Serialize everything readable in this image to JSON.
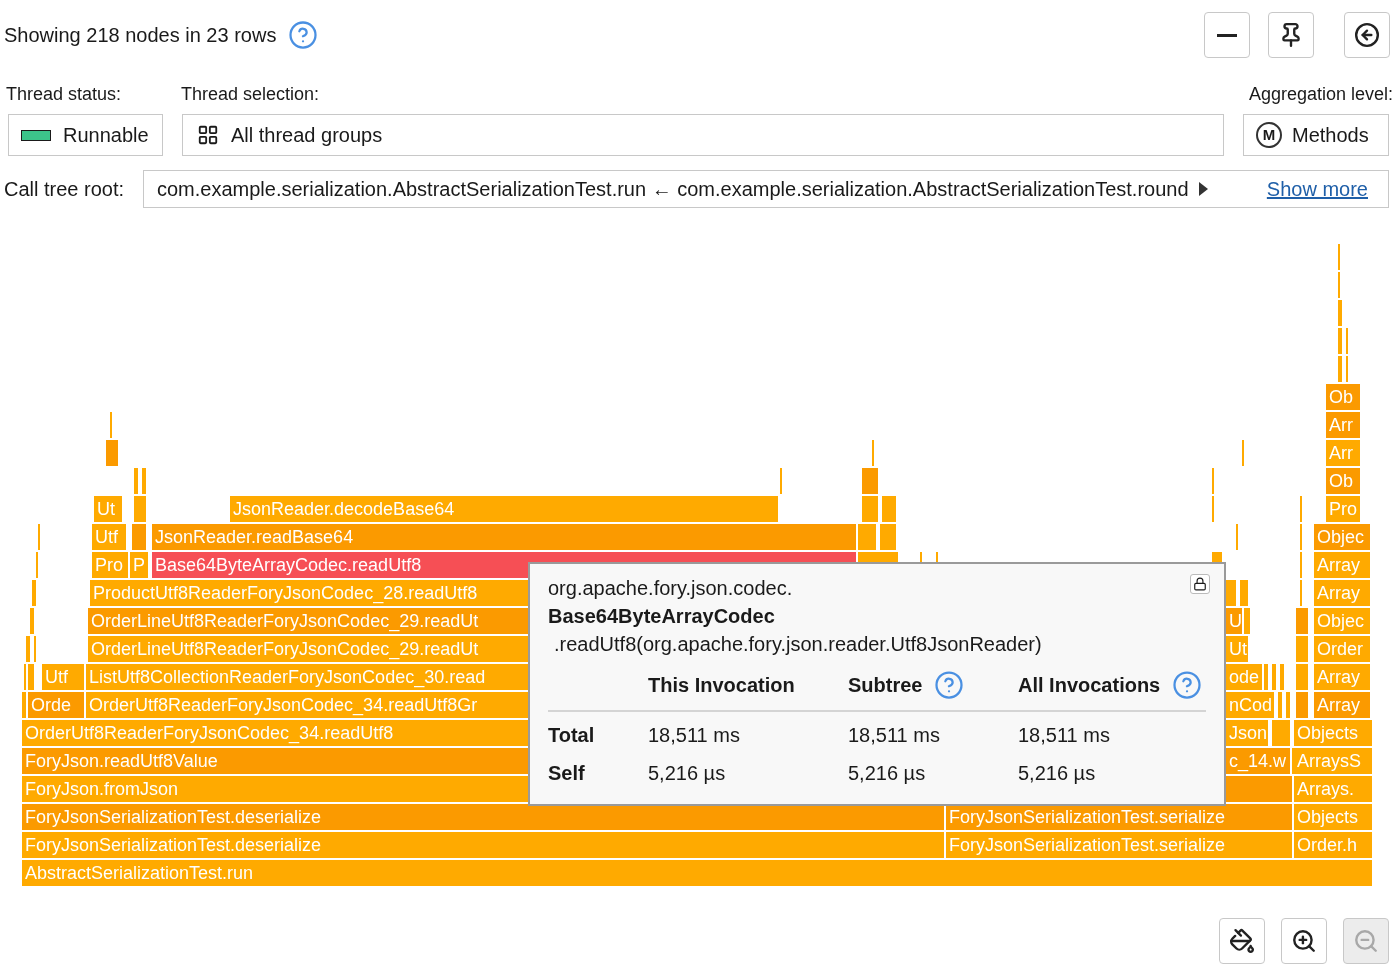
{
  "header": {
    "summary": "Showing 218 nodes in 23 rows"
  },
  "toolbar": [
    {
      "kind": "collapse",
      "disabled": false
    },
    {
      "kind": "pin",
      "disabled": false
    },
    {
      "kind": "back",
      "disabled": false
    }
  ],
  "thread_status": {
    "label": "Thread status:",
    "value": "Runnable",
    "color": "#3cc48a"
  },
  "thread_selection": {
    "label": "Thread selection:",
    "value": "All thread groups"
  },
  "aggregation": {
    "label": "Aggregation level:",
    "icon_letter": "M",
    "value": "Methods"
  },
  "call_tree_root": {
    "label": "Call tree root:",
    "value": "com.example.serialization.AbstractSerializationTest.run ← com.example.serialization.AbstractSerializationTest.round",
    "link": "Show more"
  },
  "frames": [
    {
      "label": "Ob",
      "selected": false
    },
    {
      "label": "Arr",
      "selected": false
    },
    {
      "label": "Arr",
      "selected": false
    },
    {
      "label": "Ob",
      "selected": false
    },
    {
      "label": "Ut",
      "selected": false
    },
    {
      "label": "JsonReader.decodeBase64",
      "selected": false
    },
    {
      "label": "Pro",
      "selected": false
    },
    {
      "label": "Utf",
      "selected": false
    },
    {
      "label": "JsonReader.readBase64",
      "selected": false
    },
    {
      "label": "Objec",
      "selected": false
    },
    {
      "label": "Pro",
      "selected": false
    },
    {
      "label": "P",
      "selected": false
    },
    {
      "label": "Base64ByteArrayCodec.readUtf8",
      "selected": true
    },
    {
      "label": "Array",
      "selected": false
    },
    {
      "label": "ProductUtf8ReaderForyJsonCodec_28.readUtf8",
      "selected": false
    },
    {
      "label": "Array",
      "selected": false
    },
    {
      "label": "OrderLineUtf8ReaderForyJsonCodec_29.readUt",
      "selected": false
    },
    {
      "label": "U",
      "selected": false
    },
    {
      "label": "Objec",
      "selected": false
    },
    {
      "label": "OrderLineUtf8ReaderForyJsonCodec_29.readUt",
      "selected": false
    },
    {
      "label": "Ut",
      "selected": false
    },
    {
      "label": "Order",
      "selected": false
    },
    {
      "label": "Utf",
      "selected": false
    },
    {
      "label": "ListUtf8CollectionReaderForyJsonCodec_30.read",
      "selected": false
    },
    {
      "label": "ode",
      "selected": false
    },
    {
      "label": "Array",
      "selected": false
    },
    {
      "label": "Orde",
      "selected": false
    },
    {
      "label": "OrderUtf8ReaderForyJsonCodec_34.readUtf8Gr",
      "selected": false
    },
    {
      "label": "nCod",
      "selected": false
    },
    {
      "label": "Array",
      "selected": false
    },
    {
      "label": "OrderUtf8ReaderForyJsonCodec_34.readUtf8",
      "selected": false
    },
    {
      "label": "Json",
      "selected": false
    },
    {
      "label": "Objects",
      "selected": false
    },
    {
      "label": "ForyJson.readUtf8Value",
      "selected": false
    },
    {
      "label": "c_14.w",
      "selected": false
    },
    {
      "label": "ArraysS",
      "selected": false
    },
    {
      "label": "ForyJson.fromJson",
      "selected": false
    },
    {
      "label": "Arrays.",
      "selected": false
    },
    {
      "label": "ForyJsonSerializationTest.deserialize",
      "selected": false
    },
    {
      "label": "ForyJsonSerializationTest.serialize",
      "selected": false
    },
    {
      "label": "Objects",
      "selected": false
    },
    {
      "label": "ForyJsonSerializationTest.deserialize",
      "selected": false
    },
    {
      "label": "ForyJsonSerializationTest.serialize",
      "selected": false
    },
    {
      "label": "Order.h",
      "selected": false
    },
    {
      "label": "AbstractSerializationTest.run",
      "selected": false
    }
  ],
  "tooltip": {
    "package": "org.apache.fory.json.codec.",
    "class_name": "Base64ByteArrayCodec",
    "signature": ".readUtf8(org.apache.fory.json.reader.Utf8JsonReader)",
    "columns": [
      {
        "label": "This Invocation",
        "kind": "plain"
      },
      {
        "label": "Subtree",
        "kind": "help"
      },
      {
        "label": "All Invocations",
        "kind": "help"
      }
    ],
    "rows": [
      {
        "label": "Total",
        "values": [
          "18,511 ms",
          "18,511 ms",
          "18,511 ms"
        ]
      },
      {
        "label": "Self",
        "values": [
          "5,216 µs",
          "5,216 µs",
          "5,216 µs"
        ]
      }
    ]
  },
  "bottom_tools": [
    {
      "kind": "color",
      "disabled": false
    },
    {
      "kind": "zoom_in",
      "disabled": false
    },
    {
      "kind": "zoom_out",
      "disabled": true
    }
  ]
}
